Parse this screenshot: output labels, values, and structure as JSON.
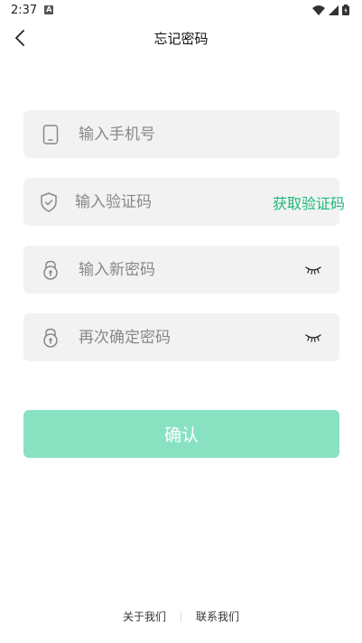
{
  "status_bar": {
    "time": "2:37",
    "notification_letter": "A"
  },
  "nav": {
    "title": "忘记密码"
  },
  "form": {
    "phone_placeholder": "输入手机号",
    "code_placeholder": "输入验证码",
    "get_code_label": "获取验证码",
    "new_password_placeholder": "输入新密码",
    "confirm_password_placeholder": "再次确定密码"
  },
  "confirm_label": "确认",
  "footer": {
    "about_label": "关于我们",
    "contact_label": "联系我们"
  },
  "colors": {
    "accent": "#1fb97a",
    "button_bg": "#88e2c2",
    "field_bg": "#f1f2f1"
  },
  "icons": {
    "back": "chevron-left-icon",
    "phone": "phone-icon",
    "shield": "shield-check-icon",
    "lock": "lock-icon",
    "eye_closed": "eye-closed-icon"
  }
}
